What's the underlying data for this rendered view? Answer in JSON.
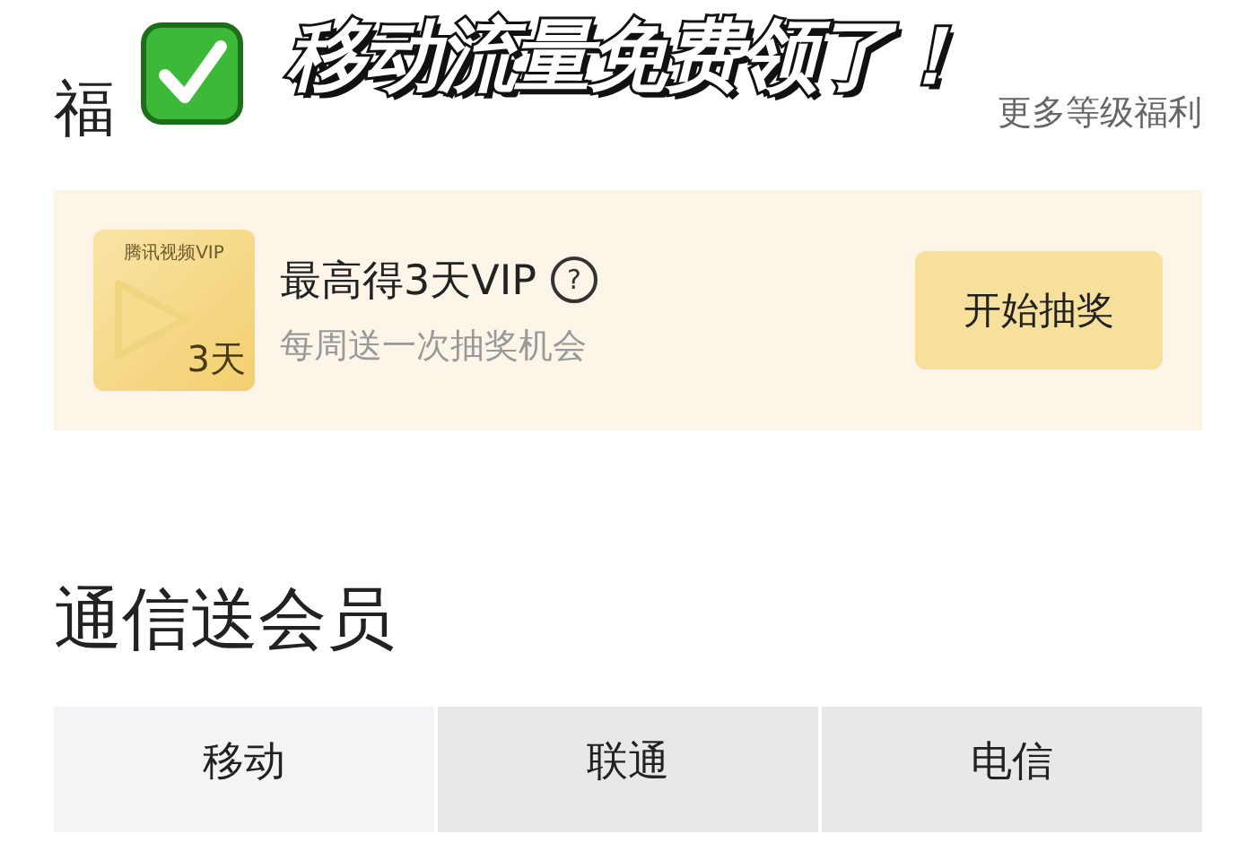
{
  "caption": "移动流量免费领了！",
  "welfare": {
    "title": "福",
    "more_link": "更多等级福利"
  },
  "lottery": {
    "badge_title": "腾讯视频VIP",
    "badge_days": "3天",
    "title": "最高得3天VIP",
    "help": "?",
    "subtitle": "每周送一次抽奖机会",
    "button": "开始抽奖"
  },
  "membership": {
    "title": "通信送会员",
    "tabs": [
      {
        "label": "移动",
        "selected": true
      },
      {
        "label": "联通",
        "selected": false
      },
      {
        "label": "电信",
        "selected": false
      }
    ]
  }
}
